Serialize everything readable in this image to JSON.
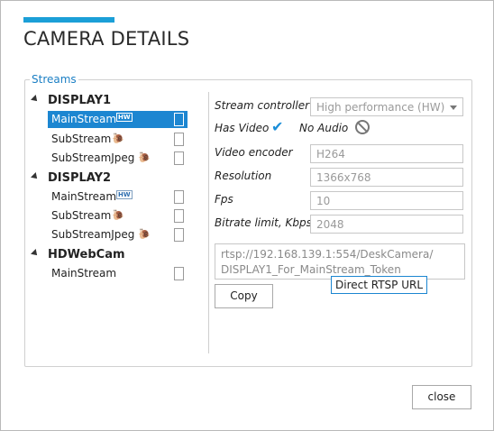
{
  "window": {
    "title": "CAMERA DETAILS"
  },
  "streams": {
    "group_label": "Streams",
    "devices": [
      {
        "name": "DISPLAY1",
        "streams": [
          {
            "name": "MainStream",
            "badge": "HW",
            "selected": true
          },
          {
            "name": "SubStream",
            "icon": "snail-icon"
          },
          {
            "name": "SubStreamJpeg",
            "icon": "snail-icon"
          }
        ]
      },
      {
        "name": "DISPLAY2",
        "streams": [
          {
            "name": "MainStream",
            "badge": "HW"
          },
          {
            "name": "SubStream",
            "icon": "snail-icon"
          },
          {
            "name": "SubStreamJpeg",
            "icon": "snail-icon"
          }
        ]
      },
      {
        "name": "HDWebCam",
        "streams": [
          {
            "name": "MainStream"
          }
        ]
      }
    ]
  },
  "details": {
    "stream_controller_label": "Stream controller",
    "stream_controller_value": "High performance (HW)",
    "has_video_label": "Has Video",
    "no_audio_label": "No Audio",
    "video_encoder_label": "Video encoder",
    "video_encoder_value": "H264",
    "resolution_label": "Resolution",
    "resolution_value": "1366x768",
    "fps_label": "Fps",
    "fps_value": "10",
    "bitrate_label": "Bitrate limit, Kbps",
    "bitrate_value": "2048",
    "rtsp_url_line1": "rtsp://192.168.139.1:554/DeskCamera/",
    "rtsp_url_line2": "DISPLAY1_For_MainStream_Token",
    "copy_button": "Copy",
    "tooltip": "Direct RTSP URL"
  },
  "footer": {
    "close_button": "close"
  },
  "colors": {
    "accent": "#1b9fd7",
    "selection": "#1c86d1"
  }
}
